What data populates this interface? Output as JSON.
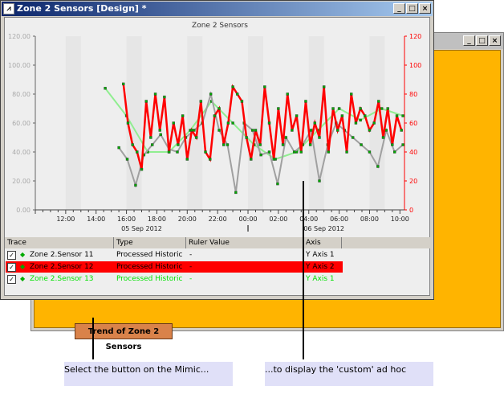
{
  "window": {
    "title": "Zone 2 Sensors [Design] *",
    "min": "_",
    "max": "□",
    "close": "×"
  },
  "chart_data": {
    "type": "line",
    "title": "Zone 2 Sensors",
    "left_axis": {
      "ylim": [
        0,
        120
      ],
      "ticks": [
        "0.00",
        "20.00",
        "40.00",
        "60.00",
        "80.00",
        "100.00",
        "120.00"
      ]
    },
    "right_axis": {
      "ylim": [
        0,
        120
      ],
      "ticks": [
        "0",
        "20",
        "40",
        "60",
        "80",
        "100",
        "120"
      ],
      "color": "#ff0000"
    },
    "x_hours_range": [
      10,
      34.3
    ],
    "x_ticks": [
      {
        "h": 12,
        "label": "12:00"
      },
      {
        "h": 14,
        "label": "14:00"
      },
      {
        "h": 16,
        "label": "16:00"
      },
      {
        "h": 18,
        "label": "18:00"
      },
      {
        "h": 20,
        "label": "20:00"
      },
      {
        "h": 22,
        "label": "22:00"
      },
      {
        "h": 24,
        "label": "00:00"
      },
      {
        "h": 26,
        "label": "02:00"
      },
      {
        "h": 28,
        "label": "04:00"
      },
      {
        "h": 30,
        "label": "06:00"
      },
      {
        "h": 32,
        "label": "08:00"
      },
      {
        "h": 34,
        "label": "10:00"
      }
    ],
    "date_labels": [
      {
        "h": 17,
        "label": "05 Sep 2012"
      },
      {
        "h": 29,
        "label": "06 Sep 2012"
      }
    ],
    "series": [
      {
        "name": "Zone 2.Sensor 12",
        "color": "#ff0000",
        "start": 15.8,
        "step": 0.3,
        "values": [
          87,
          60,
          45,
          40,
          28,
          75,
          50,
          80,
          55,
          78,
          40,
          60,
          45,
          65,
          35,
          55,
          50,
          75,
          40,
          35,
          65,
          70,
          45,
          60,
          85,
          80,
          75,
          50,
          35,
          55,
          45,
          85,
          60,
          35,
          70,
          45,
          80,
          55,
          65,
          40,
          75,
          45,
          60,
          50,
          85,
          40,
          70,
          55,
          65,
          40,
          80,
          60,
          70,
          65,
          55,
          60,
          75,
          50,
          70,
          45,
          65,
          55,
          75,
          50,
          60,
          55,
          68,
          60,
          45,
          73,
          62,
          70
        ]
      },
      {
        "name": "Zone 2.Sensor 11",
        "color": "#a0a0a0",
        "start": 15.5,
        "step": 0.55,
        "values": [
          43,
          35,
          17,
          38,
          45,
          52,
          42,
          40,
          50,
          55,
          60,
          80,
          55,
          45,
          12,
          60,
          55,
          38,
          40,
          18,
          50,
          40,
          45,
          55,
          20,
          45,
          60,
          55,
          50,
          45,
          40,
          30,
          55,
          40,
          45,
          50
        ]
      },
      {
        "name": "Zone 2.Sensor 13",
        "color": "#90ee90",
        "start": 14.6,
        "step": 1.4,
        "values": [
          84,
          65,
          40,
          40,
          55,
          75,
          60,
          45,
          35,
          40,
          55,
          70,
          62,
          70,
          65,
          60,
          70,
          68
        ]
      }
    ]
  },
  "table": {
    "headers": [
      "Trace",
      "Type",
      "Ruler Value",
      "Axis"
    ],
    "rows": [
      {
        "trace": "Zone 2.Sensor 11",
        "type": "Processed Historic",
        "ruler": "-",
        "axis": "Y Axis 1",
        "color": "#000000",
        "bg": "transparent",
        "check": "✓"
      },
      {
        "trace": "Zone 2.Sensor 12",
        "type": "Processed Historic",
        "ruler": "-",
        "axis": "Y Axis 2",
        "color": "#000000",
        "bg": "#ff0000",
        "check": "✓"
      },
      {
        "trace": "Zone 2.Sensor 13",
        "type": "Processed Historic",
        "ruler": "-",
        "axis": "Y Axis 1",
        "color": "#00e000",
        "bg": "transparent",
        "check": "✓"
      }
    ]
  },
  "mimic": {
    "button": "Trend of Zone 2 Sensors"
  },
  "captions": [
    "Select the button on the Mimic...",
    "...to display the 'custom' ad hoc"
  ]
}
